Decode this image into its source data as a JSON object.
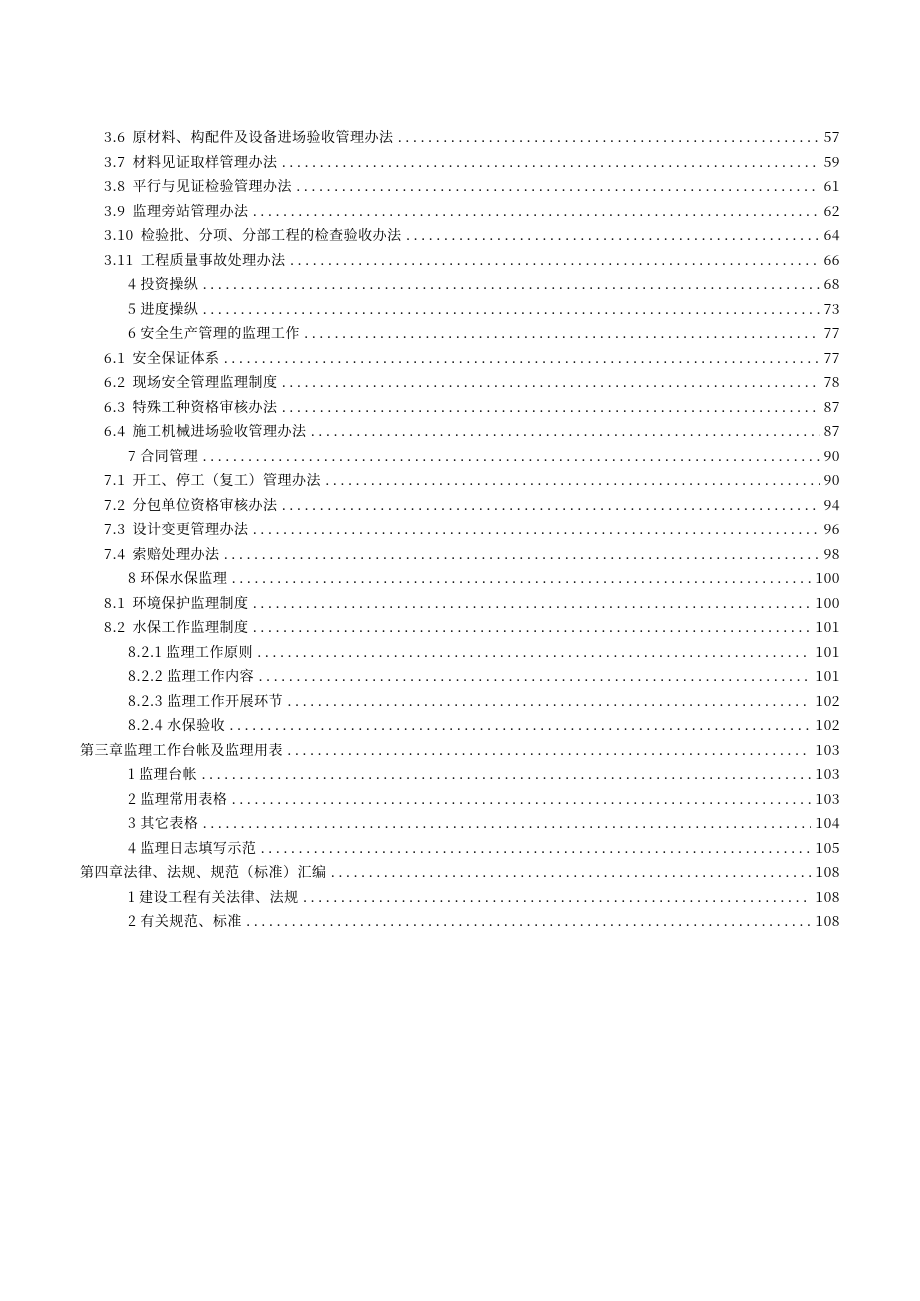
{
  "toc": {
    "entries": [
      {
        "num": "3.6",
        "title": "原材料、构配件及设备进场验收管理办法",
        "page": "57",
        "indent": 1,
        "hasNum": true
      },
      {
        "num": "3.7",
        "title": "材料见证取样管理办法",
        "page": "59",
        "indent": 1,
        "hasNum": true
      },
      {
        "num": "3.8",
        "title": "平行与见证检验管理办法",
        "page": "61",
        "indent": 1,
        "hasNum": true
      },
      {
        "num": "3.9",
        "title": "监理旁站管理办法",
        "page": "62",
        "indent": 1,
        "hasNum": true
      },
      {
        "num": "3.10",
        "title": "检验批、分项、分部工程的检查验收办法",
        "page": "64",
        "indent": 1,
        "hasNum": true
      },
      {
        "num": "3.11",
        "title": "工程质量事故处理办法",
        "page": "66",
        "indent": 1,
        "hasNum": true
      },
      {
        "num": "",
        "title": "4 投资操纵",
        "page": "68",
        "indent": 2,
        "hasNum": false
      },
      {
        "num": "",
        "title": "5 进度操纵",
        "page": "73",
        "indent": 2,
        "hasNum": false
      },
      {
        "num": "",
        "title": "6 安全生产管理的监理工作",
        "page": "77",
        "indent": 2,
        "hasNum": false
      },
      {
        "num": "6.1",
        "title": "安全保证体系",
        "page": "77",
        "indent": 1,
        "hasNum": true
      },
      {
        "num": "6.2",
        "title": "现场安全管理监理制度",
        "page": "78",
        "indent": 1,
        "hasNum": true
      },
      {
        "num": "6.3",
        "title": "特殊工种资格审核办法",
        "page": "87",
        "indent": 1,
        "hasNum": true
      },
      {
        "num": "6.4",
        "title": "施工机械进场验收管理办法",
        "page": "87",
        "indent": 1,
        "hasNum": true
      },
      {
        "num": "",
        "title": "7 合同管理",
        "page": "90",
        "indent": 2,
        "hasNum": false
      },
      {
        "num": "7.1",
        "title": "开工、停工（复工）管理办法",
        "page": "90",
        "indent": 1,
        "hasNum": true
      },
      {
        "num": "7.2",
        "title": "分包单位资格审核办法",
        "page": "94",
        "indent": 1,
        "hasNum": true
      },
      {
        "num": "7.3",
        "title": "设计变更管理办法",
        "page": "96",
        "indent": 1,
        "hasNum": true
      },
      {
        "num": "7.4",
        "title": "索赔处理办法",
        "page": "98",
        "indent": 1,
        "hasNum": true
      },
      {
        "num": "",
        "title": "8 环保水保监理",
        "page": "100",
        "indent": 2,
        "hasNum": false
      },
      {
        "num": "8.1",
        "title": "环境保护监理制度",
        "page": "100",
        "indent": 1,
        "hasNum": true
      },
      {
        "num": "8.2",
        "title": "水保工作监理制度",
        "page": "101",
        "indent": 1,
        "hasNum": true
      },
      {
        "num": "",
        "title": "8.2.1 监理工作原则",
        "page": "101",
        "indent": 3,
        "hasNum": false
      },
      {
        "num": "",
        "title": "8.2.2 监理工作内容",
        "page": "101",
        "indent": 3,
        "hasNum": false
      },
      {
        "num": "",
        "title": "8.2.3 监理工作开展环节",
        "page": "102",
        "indent": 3,
        "hasNum": false
      },
      {
        "num": "",
        "title": "8.2.4 水保验收",
        "page": "102",
        "indent": 3,
        "hasNum": false
      },
      {
        "num": "",
        "title": "第三章监理工作台帐及监理用表",
        "page": "103",
        "indent": 0,
        "hasNum": false
      },
      {
        "num": "",
        "title": "1 监理台帐",
        "page": "103",
        "indent": 2,
        "hasNum": false
      },
      {
        "num": "",
        "title": "2 监理常用表格",
        "page": "103",
        "indent": 2,
        "hasNum": false
      },
      {
        "num": "",
        "title": "3 其它表格",
        "page": "104",
        "indent": 2,
        "hasNum": false
      },
      {
        "num": "",
        "title": "4 监理日志填写示范",
        "page": "105",
        "indent": 2,
        "hasNum": false
      },
      {
        "num": "",
        "title": "第四章法律、法规、规范（标准）汇编",
        "page": "108",
        "indent": 0,
        "hasNum": false
      },
      {
        "num": "",
        "title": "1 建设工程有关法律、法规",
        "page": "108",
        "indent": 2,
        "hasNum": false
      },
      {
        "num": "",
        "title": "2 有关规范、标准",
        "page": "108",
        "indent": 2,
        "hasNum": false
      }
    ]
  }
}
